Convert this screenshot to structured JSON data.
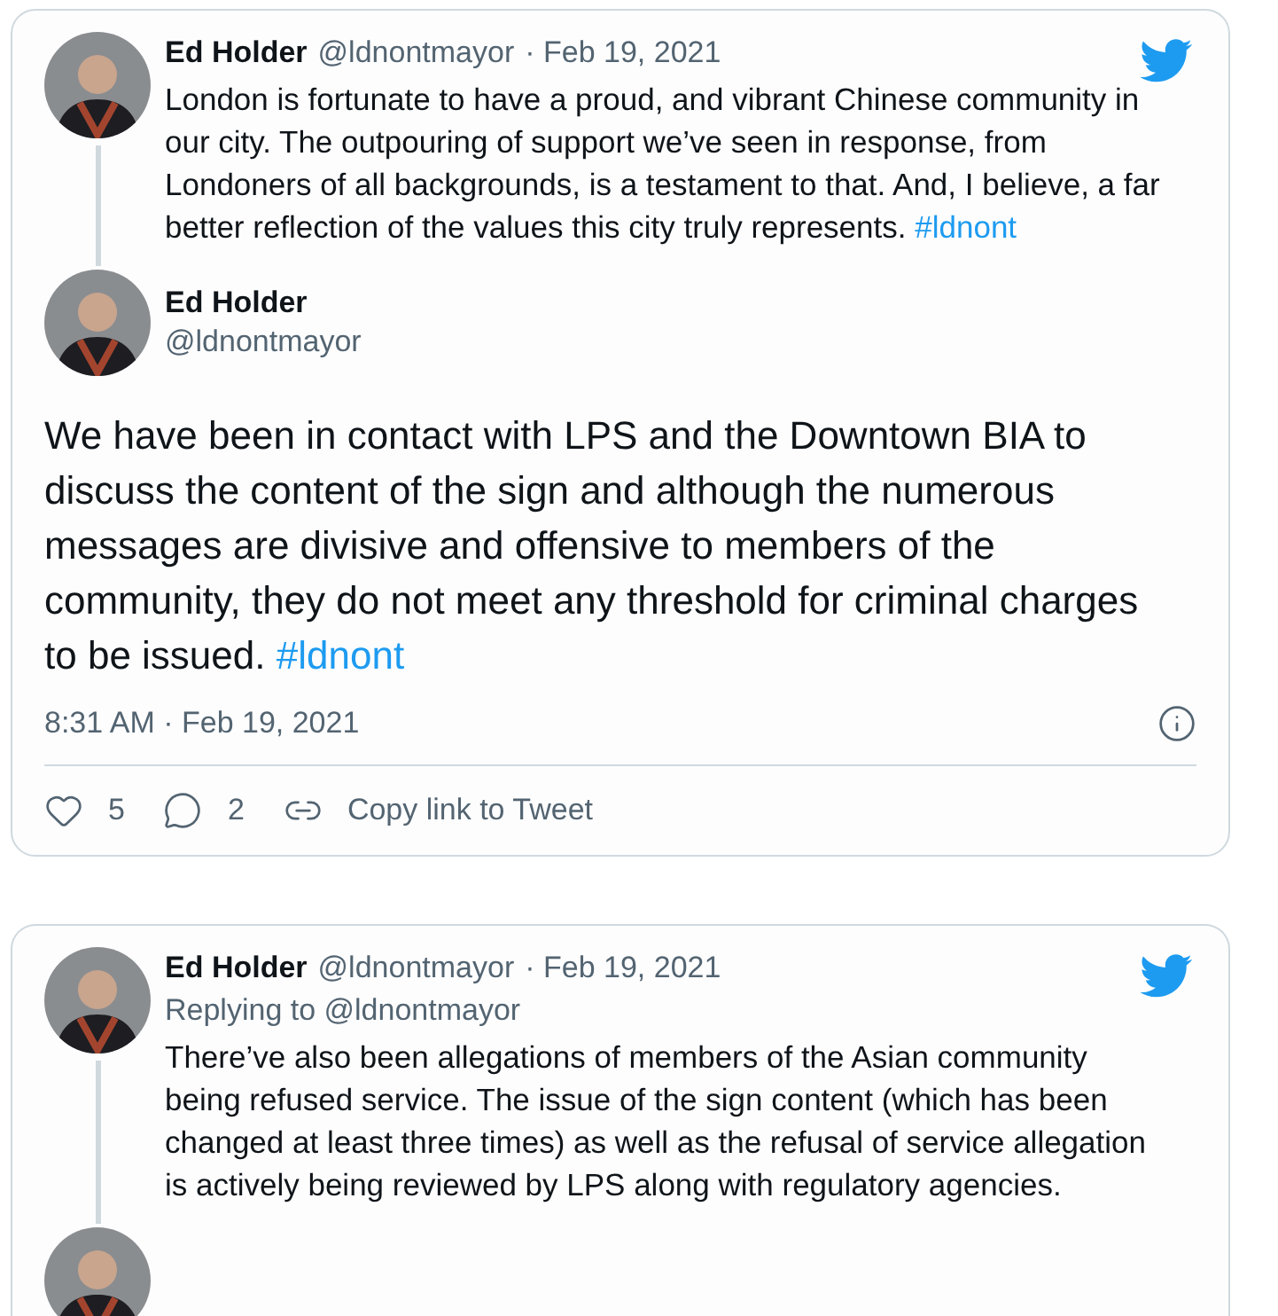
{
  "tweets": [
    {
      "kind": "thread",
      "parent": {
        "name": "Ed Holder",
        "handle": "@ldnontmayor",
        "date": "· Feb 19, 2021",
        "text": "London is fortunate to have a proud, and vibrant Chinese community in our city. The outpouring of support we’ve seen in response, from Londoners of all backgrounds, is a testament to that. And, I believe, a far better reflection of the values this city truly represents.",
        "hashtag": "#ldnont"
      },
      "main": {
        "name": "Ed Holder",
        "handle": "@ldnontmayor",
        "text": "We have been in contact with LPS and the Downtown BIA to discuss the content of the sign and although the numerous messages are divisive and offensive to members of the community, they do not meet any threshold for criminal charges to be issued.",
        "hashtag": "#ldnont",
        "time": "8:31 AM · Feb 19, 2021",
        "likes": "5",
        "replies": "2",
        "copy_link": "Copy link to Tweet"
      }
    },
    {
      "kind": "reply",
      "parent": {
        "name": "Ed Holder",
        "handle": "@ldnontmayor",
        "date": "· Feb 19, 2021",
        "replying": "Replying to @ldnontmayor",
        "text": "There’ve also been allegations of members of the Asian community being refused service. The issue of the sign content (which has been changed at least three times) as well as the refusal of service allegation is actively being reviewed by LPS along with regulatory agencies.",
        "continues": true
      }
    }
  ]
}
